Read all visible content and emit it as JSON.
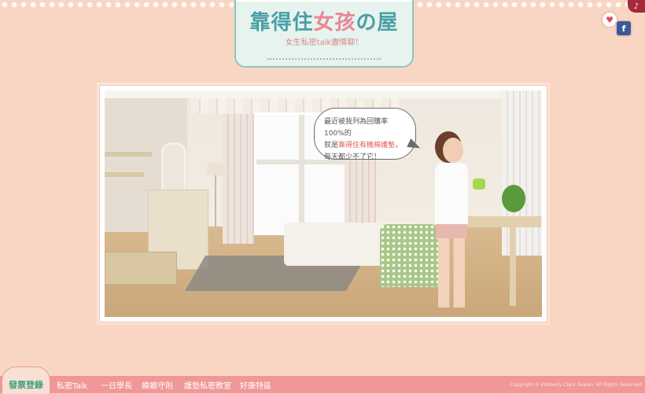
{
  "header": {
    "logo_title_a": "靠得住",
    "logo_title_b": "女孩",
    "logo_title_c": "の屋",
    "logo_subtitle": "女生私密talk盡情聊！"
  },
  "top_icons": [
    {
      "name": "heart-icon",
      "glyph": "♥"
    },
    {
      "name": "facebook-icon",
      "glyph": "f"
    },
    {
      "name": "music-icon",
      "glyph": "♪"
    }
  ],
  "speech_bubble": {
    "line1": "最近被我列為回購率100%的",
    "line2_prefix": "就是",
    "line2_highlight": "靠得住有機棉護墊",
    "line2_suffix": "，",
    "line3": "每天都少不了它！"
  },
  "nav": {
    "main_label": "發票登錄",
    "items": [
      "私密Talk",
      "一日學長",
      "蟑螂守則",
      "護墊私密教室",
      "好康特區"
    ]
  },
  "footer": {
    "copyright": "Copyright © Kimberly-Clark Taiwan. All Rights Reserved"
  },
  "colors": {
    "background": "#f9d6c3",
    "nav_bar": "#f09797",
    "highlight": "#e45a5a",
    "logo_teal": "#4a9fa6"
  }
}
